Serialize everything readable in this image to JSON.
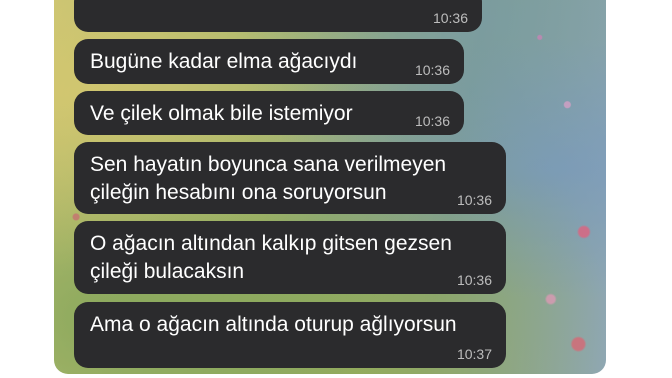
{
  "chat": {
    "messages": [
      {
        "text": "",
        "time": "10:36"
      },
      {
        "text": "Bugüne kadar elma ağacıydı",
        "time": "10:36"
      },
      {
        "text": "Ve çilek olmak bile istemiyor",
        "time": "10:36"
      },
      {
        "text": "Sen hayatın boyunca sana verilmeyen\nçileğin hesabını ona soruyorsun",
        "time": "10:36"
      },
      {
        "text": "O ağacın altından kalkıp gitsen gezsen\nçileği bulacaksın",
        "time": "10:36"
      },
      {
        "text": "Ama o ağacın altında oturup ağlıyorsun",
        "time": "10:37"
      }
    ]
  }
}
